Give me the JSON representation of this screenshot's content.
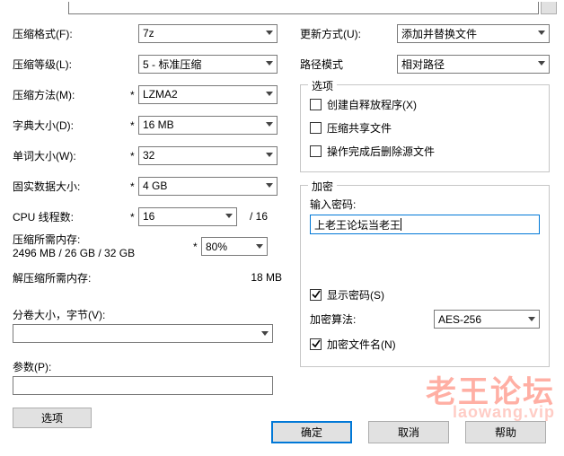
{
  "left": {
    "archive_format": {
      "label": "压缩格式(F):",
      "value": "7z"
    },
    "compression_level": {
      "label": "压缩等级(L):",
      "value": "5 - 标准压缩"
    },
    "method": {
      "label": "压缩方法(M):",
      "value": "LZMA2"
    },
    "dict_size": {
      "label": "字典大小(D):",
      "value": "16 MB"
    },
    "word_size": {
      "label": "单词大小(W):",
      "value": "32"
    },
    "solid_block": {
      "label": "固实数据大小:",
      "value": "4 GB"
    },
    "cpu_threads": {
      "label": "CPU 线程数:",
      "value": "16",
      "suffix": "/ 16"
    },
    "mem_compress": {
      "label": "压缩所需内存:",
      "detail": "2496 MB / 26 GB / 32 GB",
      "value": "80%"
    },
    "mem_decompress": {
      "label": "解压缩所需内存:",
      "value": "18 MB"
    },
    "split": {
      "label": "分卷大小，字节(V):",
      "value": ""
    },
    "params": {
      "label": "参数(P):",
      "value": ""
    },
    "options_button": "选项"
  },
  "right": {
    "update_mode": {
      "label": "更新方式(U):",
      "value": "添加并替换文件"
    },
    "path_mode": {
      "label": "路径模式",
      "value": "相对路径"
    },
    "options_group": {
      "title": "选项",
      "sfx": {
        "label": "创建自释放程序(X)",
        "checked": false
      },
      "shared": {
        "label": "压缩共享文件",
        "checked": false
      },
      "delete_src": {
        "label": "操作完成后删除源文件",
        "checked": false
      }
    },
    "encryption_group": {
      "title": "加密",
      "password_label": "输入密码:",
      "password_value": "上老王论坛当老王",
      "show_password": {
        "label": "显示密码(S)",
        "checked": true
      },
      "method": {
        "label": "加密算法:",
        "value": "AES-256"
      },
      "encrypt_names": {
        "label": "加密文件名(N)",
        "checked": true
      }
    }
  },
  "bottom": {
    "ok": "确定",
    "cancel": "取消",
    "help": "帮助"
  },
  "watermark": {
    "line1": "老王论坛",
    "line2": "laowang.vip"
  }
}
